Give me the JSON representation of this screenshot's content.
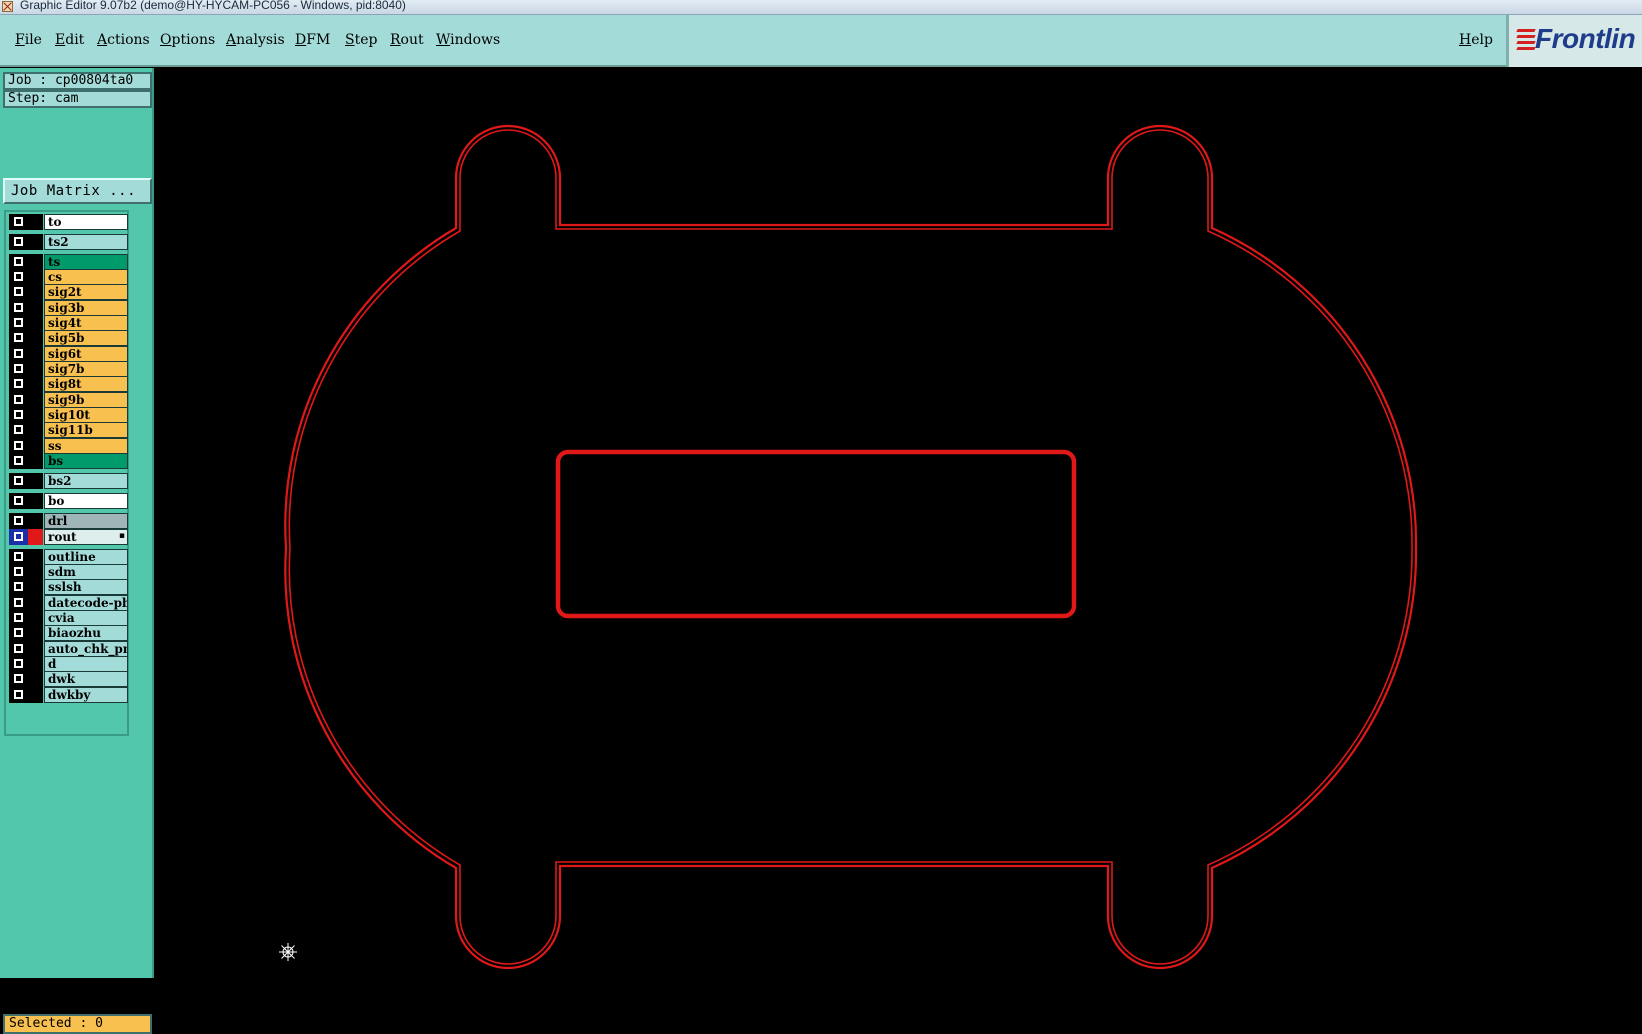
{
  "window": {
    "title": "Graphic Editor 9.07b2 (demo@HY-HYCAM-PC056 - Windows, pid:8040)"
  },
  "menu": {
    "file": "File",
    "edit": "Edit",
    "actions": "Actions",
    "options": "Options",
    "analysis": "Analysis",
    "dfm": "DFM",
    "step": "Step",
    "rout": "Rout",
    "windows": "Windows",
    "help": "Help"
  },
  "logo": {
    "text": "Frontlin"
  },
  "panel": {
    "job": "Job : cp00804ta0",
    "step": "Step: cam",
    "job_matrix_button": "Job Matrix ...",
    "selected": "Selected : 0"
  },
  "layers": [
    {
      "name": "to",
      "color": "#ffffff"
    },
    {
      "name": "ts2",
      "color": "#a3dbd8"
    },
    {
      "name": "ts",
      "color": "#009a6b"
    },
    {
      "name": "cs",
      "color": "#f7c04f"
    },
    {
      "name": "sig2t",
      "color": "#f7c04f"
    },
    {
      "name": "sig3b",
      "color": "#f7c04f"
    },
    {
      "name": "sig4t",
      "color": "#f7c04f"
    },
    {
      "name": "sig5b",
      "color": "#f7c04f"
    },
    {
      "name": "sig6t",
      "color": "#f7c04f"
    },
    {
      "name": "sig7b",
      "color": "#f7c04f"
    },
    {
      "name": "sig8t",
      "color": "#f7c04f"
    },
    {
      "name": "sig9b",
      "color": "#f7c04f"
    },
    {
      "name": "sig10t",
      "color": "#f7c04f"
    },
    {
      "name": "sig11b",
      "color": "#f7c04f"
    },
    {
      "name": "ss",
      "color": "#f7c04f"
    },
    {
      "name": "bs",
      "color": "#009a6b"
    },
    {
      "name": "bs2",
      "color": "#a3dbd8"
    },
    {
      "name": "bo",
      "color": "#ffffff"
    },
    {
      "name": "drl",
      "color": "#9fb5b8"
    },
    {
      "name": "rout",
      "color": "#ddeeed",
      "active": true
    },
    {
      "name": "outline",
      "color": "#a3dbd8"
    },
    {
      "name": "sdm",
      "color": "#a3dbd8"
    },
    {
      "name": "sslsh",
      "color": "#a3dbd8"
    },
    {
      "name": "datecode-pbe",
      "color": "#a3dbd8"
    },
    {
      "name": "cvia",
      "color": "#a3dbd8"
    },
    {
      "name": "biaozhu",
      "color": "#a3dbd8"
    },
    {
      "name": "auto_chk_pnl",
      "color": "#a3dbd8"
    },
    {
      "name": "d",
      "color": "#a3dbd8"
    },
    {
      "name": "dwk",
      "color": "#a3dbd8"
    },
    {
      "name": "dwkby",
      "color": "#a3dbd8"
    }
  ],
  "colors": {
    "rout_stroke": "#e01818",
    "canvas_bg": "#000000"
  }
}
